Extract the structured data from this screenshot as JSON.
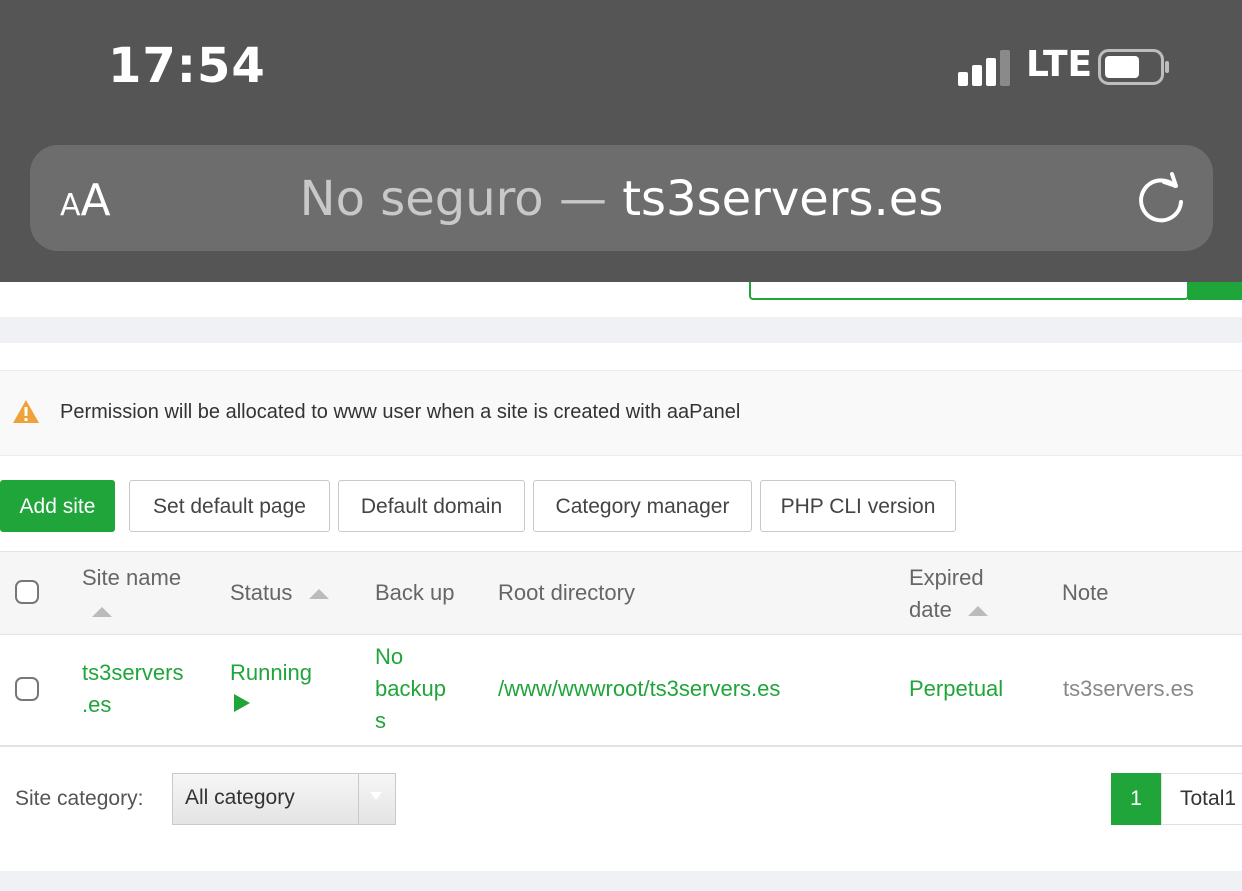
{
  "status_bar": {
    "time": "17:54",
    "network": "LTE"
  },
  "address_bar": {
    "text_size_label_small": "A",
    "text_size_label_big": "A",
    "security_label": "No seguro",
    "separator": "—",
    "domain": "ts3servers.es"
  },
  "notice": {
    "text": "Permission will be allocated to www user when a site is created with aaPanel"
  },
  "toolbar": {
    "add_site": "Add site",
    "set_default_page": "Set default page",
    "default_domain": "Default domain",
    "category_manager": "Category manager",
    "php_cli_version": "PHP CLI version"
  },
  "table": {
    "headers": {
      "site_name": "Site name",
      "status": "Status",
      "backup": "Back up",
      "root_directory": "Root directory",
      "expired_date_1": "Expired",
      "expired_date_2": "date",
      "note": "Note"
    },
    "rows": [
      {
        "site_name_1": "ts3servers",
        "site_name_2": ".es",
        "status": "Running",
        "backup_1": "No",
        "backup_2": "backup",
        "backup_3": "s",
        "root_directory": "/www/wwwroot/ts3servers.es",
        "expired_date": "Perpetual",
        "note": "ts3servers.es"
      }
    ]
  },
  "footer": {
    "category_label": "Site category:",
    "category_value": "All category",
    "current_page": "1",
    "total_label": "Total1"
  },
  "colors": {
    "accent": "#20a53a",
    "ios_chrome": "#555556",
    "warning": "#f0a23a"
  }
}
